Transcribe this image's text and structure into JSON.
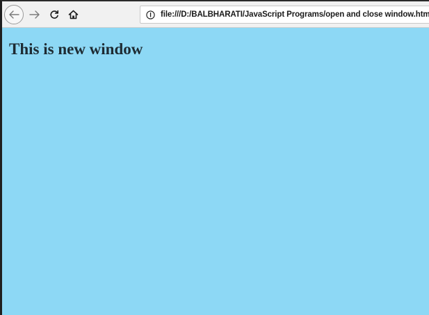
{
  "browser": {
    "address_bar": {
      "url": "file:///D:/BALBHARATI/JavaScript Programs/open and close window.html"
    },
    "nav_icons": [
      "back-arrow-icon",
      "forward-arrow-icon",
      "reload-icon",
      "home-icon",
      "info-icon"
    ]
  },
  "page": {
    "heading": "This is new window",
    "background_color": "#8dd8f5"
  }
}
